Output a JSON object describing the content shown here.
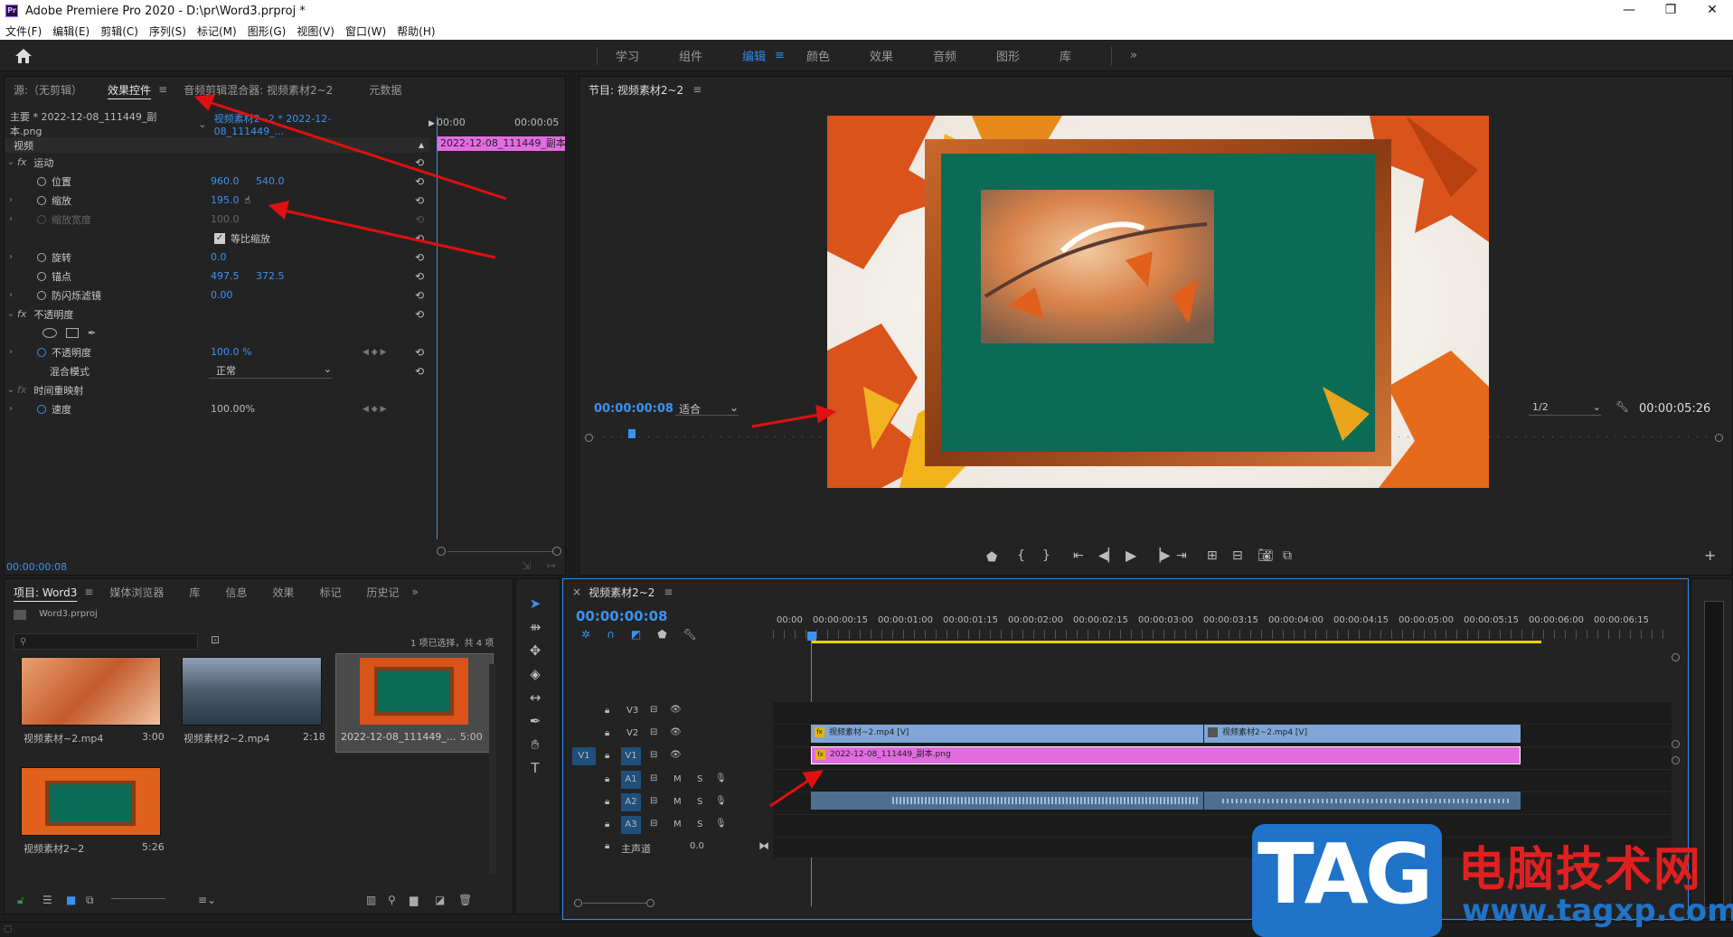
{
  "window": {
    "title": "Adobe Premiere Pro 2020 - D:\\pr\\Word3.prproj *",
    "icon": "Pr",
    "min": "—",
    "max": "❐",
    "close": "✕"
  },
  "menu": [
    "文件(F)",
    "编辑(E)",
    "剪辑(C)",
    "序列(S)",
    "标记(M)",
    "图形(G)",
    "视图(V)",
    "窗口(W)",
    "帮助(H)"
  ],
  "workspaces": [
    "学习",
    "组件",
    "编辑",
    "颜色",
    "效果",
    "音频",
    "图形",
    "库"
  ],
  "workspaces_more": "»",
  "workspace_menu": "≡",
  "source_tabs": [
    "源:（无剪辑）",
    "效果控件",
    "音频剪辑混合器: 视频素材2~2",
    "元数据"
  ],
  "ec": {
    "master": "主要 * 2022-12-08_111449_副本.png",
    "seq": "视频素材2~2 * 2022-12-08_111449_...",
    "t0": "00:00",
    "t1": "00:00:05",
    "cliplabel": "2022-12-08_111449_副本",
    "section_video": "视频",
    "motion": "运动",
    "position": "位置",
    "pos_x": "960.0",
    "pos_y": "540.0",
    "scale": "缩放",
    "scale_v": "195.0",
    "scale_w": "缩放宽度",
    "scale_w_v": "100.0",
    "uniform": "等比缩放",
    "rotation": "旋转",
    "rot_v": "0.0",
    "anchor": "锚点",
    "anc_x": "497.5",
    "anc_y": "372.5",
    "antiflicker": "防闪烁滤镜",
    "af_v": "0.00",
    "opacity_sec": "不透明度",
    "opacity": "不透明度",
    "op_v": "100.0 %",
    "blend": "混合模式",
    "blend_v": "正常",
    "timeremap": "时间重映射",
    "speed": "速度",
    "speed_v": "100.00%",
    "timecode": "00:00:00:08"
  },
  "program": {
    "title": "节目: 视频素材2~2",
    "timecode": "00:00:00:08",
    "fit": "适合",
    "res": "1/2",
    "duration": "00:00:05:26"
  },
  "project_tabs": [
    "项目: Word3",
    "媒体浏览器",
    "库",
    "信息",
    "效果",
    "标记",
    "历史记"
  ],
  "project": {
    "file": "Word3.prproj",
    "status": "1 项已选择，共 4 项",
    "items": [
      {
        "name": "视频素材~2.mp4",
        "dur": "3:00"
      },
      {
        "name": "视频素材2~2.mp4",
        "dur": "2:18"
      },
      {
        "name": "2022-12-08_111449_...",
        "dur": "5:00"
      },
      {
        "name": "视频素材2~2",
        "dur": "5:26"
      }
    ]
  },
  "timeline": {
    "title": "视频素材2~2",
    "timecode": "00:00:00:08",
    "ruler": [
      "00:00",
      "00:00:00:15",
      "00:00:01:00",
      "00:00:01:15",
      "00:00:02:00",
      "00:00:02:15",
      "00:00:03:00",
      "00:00:03:15",
      "00:00:04:00",
      "00:00:04:15",
      "00:00:05:00",
      "00:00:05:15",
      "00:00:06:00",
      "00:00:06:15"
    ],
    "tracks_v": [
      "V3",
      "V2",
      "V1"
    ],
    "tracks_a": [
      "A1",
      "A2",
      "A3"
    ],
    "src_v": "V1",
    "mix": "主声道",
    "mix_v": "0.0",
    "clip_v2a": "视频素材~2.mp4 [V]",
    "clip_v2b": "视频素材2~2.mp4 [V]",
    "clip_v1": "2022-12-08_111449_副本.png",
    "track_m": "M",
    "track_s": "S",
    "fx_badge": "fx"
  },
  "watermark": {
    "tag": "TAG",
    "cn": "电脑技术网",
    "url": "www.tagxp.com"
  },
  "colors": {
    "accent": "#2d8ceb",
    "clip_pink": "#e06ce0",
    "clip_blue": "#7fa6d6",
    "audio": "#4f6f8f",
    "arrow": "#e01010"
  }
}
